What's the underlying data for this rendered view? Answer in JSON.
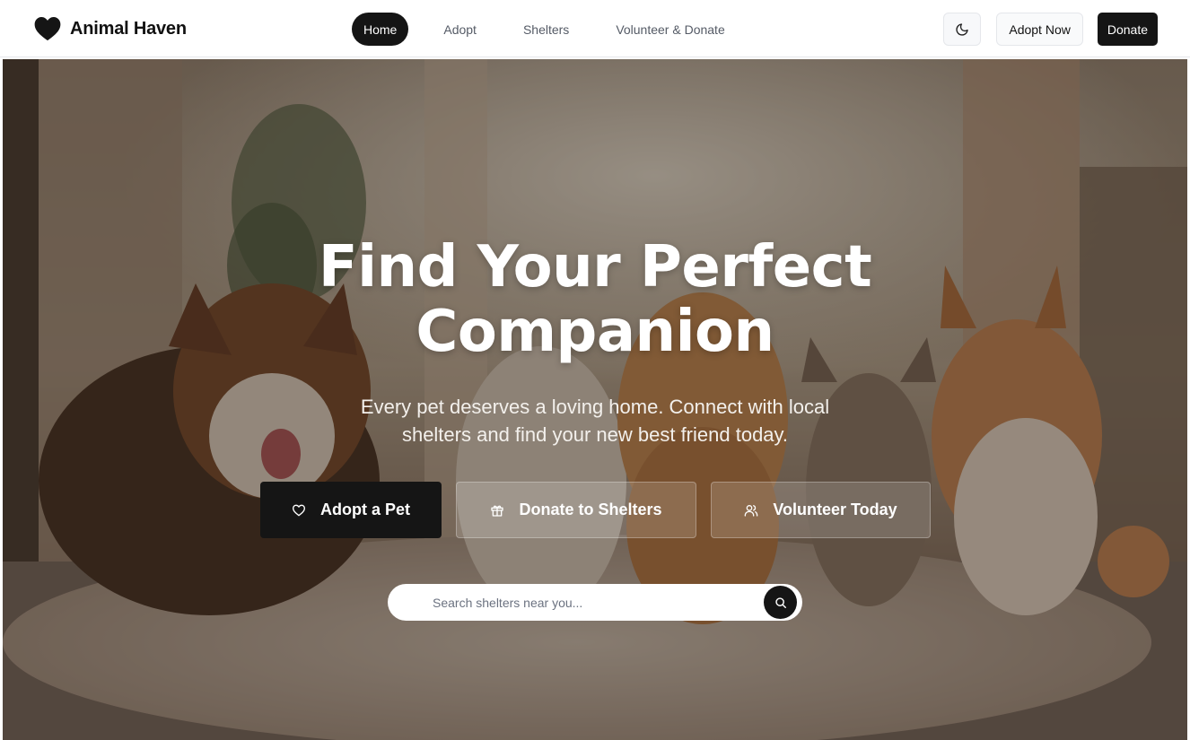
{
  "brand": {
    "name": "Animal Haven",
    "icon": "heart-icon"
  },
  "nav": {
    "items": [
      {
        "label": "Home",
        "active": true
      },
      {
        "label": "Adopt",
        "active": false
      },
      {
        "label": "Shelters",
        "active": false
      },
      {
        "label": "Volunteer & Donate",
        "active": false
      }
    ]
  },
  "header_actions": {
    "theme_toggle_icon": "moon-icon",
    "adopt_now_label": "Adopt Now",
    "donate_label": "Donate"
  },
  "hero": {
    "title_line1": "Find Your Perfect",
    "title_line2": "Companion",
    "subtitle_line1": "Every pet deserves a loving home. Connect with local",
    "subtitle_line2": "shelters and find your new best friend today.",
    "buttons": [
      {
        "label": "Adopt a Pet",
        "icon": "heart-outline-icon"
      },
      {
        "label": "Donate to Shelters",
        "icon": "gift-icon"
      },
      {
        "label": "Volunteer Today",
        "icon": "users-icon"
      }
    ],
    "search": {
      "placeholder": "Search shelters near you...",
      "value": "",
      "icon": "search-icon"
    }
  },
  "colors": {
    "primary_dark": "#151515",
    "header_bg": "#ffffff",
    "text_muted": "#555b66",
    "hero_text": "#ffffff"
  }
}
